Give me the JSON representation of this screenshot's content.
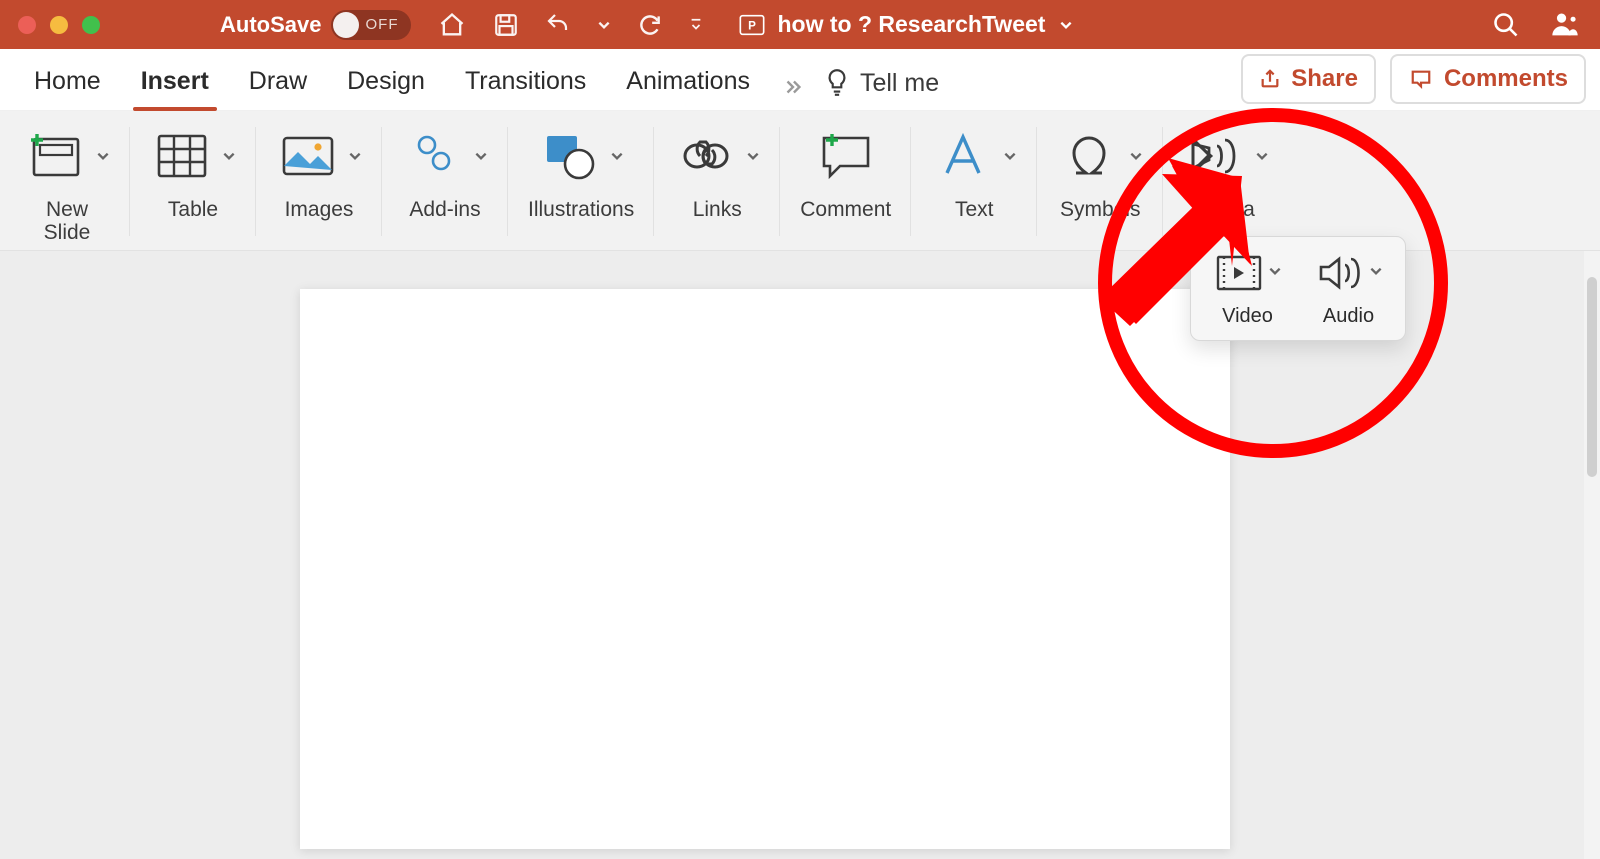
{
  "titlebar": {
    "autosave_label": "AutoSave",
    "autosave_state": "OFF",
    "document_title": "how to ? ResearchTweet"
  },
  "tabs": {
    "items": [
      {
        "label": "Home"
      },
      {
        "label": "Insert"
      },
      {
        "label": "Draw"
      },
      {
        "label": "Design"
      },
      {
        "label": "Transitions"
      },
      {
        "label": "Animations"
      }
    ],
    "active_index": 1,
    "tell_me": "Tell me",
    "share": "Share",
    "comments": "Comments"
  },
  "ribbon": {
    "groups": [
      {
        "label": "New\nSlide"
      },
      {
        "label": "Table"
      },
      {
        "label": "Images"
      },
      {
        "label": "Add-ins"
      },
      {
        "label": "Illustrations"
      },
      {
        "label": "Links"
      },
      {
        "label": "Comment"
      },
      {
        "label": "Text"
      },
      {
        "label": "Symbols"
      },
      {
        "label": "Media"
      }
    ]
  },
  "media_dropdown": {
    "items": [
      {
        "label": "Video"
      },
      {
        "label": "Audio"
      }
    ]
  },
  "colors": {
    "brand": "#c24a2e",
    "annotation": "#ff0000"
  }
}
